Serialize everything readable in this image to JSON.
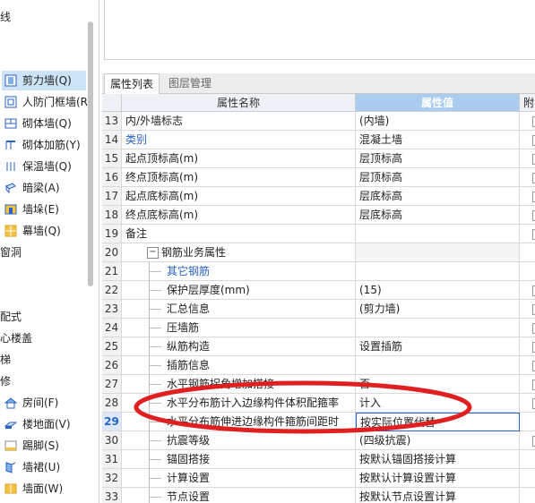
{
  "left_panel": {
    "top_text": "线",
    "items": [
      {
        "label": "剪力墙(Q)",
        "icon": "shear-wall-icon",
        "selected": true
      },
      {
        "label": "人防门框墙(R",
        "icon": "civil-defense-door-frame-icon"
      },
      {
        "label": "砌体墙(Q)",
        "icon": "masonry-wall-icon"
      },
      {
        "label": "砌体加筋(Y)",
        "icon": "masonry-reinforcement-icon"
      },
      {
        "label": "保温墙(Q)",
        "icon": "insulation-wall-icon"
      },
      {
        "label": "暗梁(A)",
        "icon": "hidden-beam-icon"
      },
      {
        "label": "墙垛(E)",
        "icon": "wall-pier-icon"
      },
      {
        "label": "幕墙(Q)",
        "icon": "curtain-wall-icon"
      }
    ],
    "group1": "窗洞",
    "group2_items": [
      "配式",
      "心楼盖",
      "梯",
      "修"
    ],
    "deco_items": [
      {
        "label": "房间(F)",
        "icon": "room-icon"
      },
      {
        "label": "楼地面(V)",
        "icon": "floor-icon"
      },
      {
        "label": "踢脚(S)",
        "icon": "skirting-icon"
      },
      {
        "label": "墙裙(U)",
        "icon": "dado-icon"
      },
      {
        "label": "墙面(W)",
        "icon": "wall-surface-icon"
      }
    ]
  },
  "tabs": [
    "属性列表",
    "图层管理"
  ],
  "grid": {
    "header": {
      "name": "属性名称",
      "value": "属性值",
      "extra": "附"
    },
    "rows": [
      {
        "num": "13",
        "name": "内/外墙标志",
        "value": "(内墙)",
        "check": true
      },
      {
        "num": "14",
        "name": "类别",
        "value": "混凝土墙",
        "check": true,
        "blue": true
      },
      {
        "num": "15",
        "name": "起点顶标高(m)",
        "value": "层顶标高",
        "check": true
      },
      {
        "num": "16",
        "name": "终点顶标高(m)",
        "value": "层顶标高",
        "check": true
      },
      {
        "num": "17",
        "name": "起点底标高(m)",
        "value": "层底标高",
        "check": true
      },
      {
        "num": "18",
        "name": "终点底标高(m)",
        "value": "层底标高",
        "check": true
      },
      {
        "num": "19",
        "name": "备注",
        "value": "",
        "check": true
      },
      {
        "num": "20",
        "name": "钢筋业务属性",
        "value": "",
        "group": true
      },
      {
        "num": "21",
        "name": "其它钢筋",
        "value": "",
        "child": true,
        "blue": true
      },
      {
        "num": "22",
        "name": "保护层厚度(mm)",
        "value": "(15)",
        "child": true,
        "check": true
      },
      {
        "num": "23",
        "name": "汇总信息",
        "value": "(剪力墙)",
        "child": true,
        "check": true
      },
      {
        "num": "24",
        "name": "压墙筋",
        "value": "",
        "child": true,
        "check": true
      },
      {
        "num": "25",
        "name": "纵筋构造",
        "value": "设置插筋",
        "child": true,
        "check": true
      },
      {
        "num": "26",
        "name": "插筋信息",
        "value": "",
        "child": true,
        "check": true
      },
      {
        "num": "27",
        "name": "水平钢筋拐角增加搭接",
        "value": "否",
        "child": true,
        "check": true
      },
      {
        "num": "28",
        "name": "水平分布筋计入边缘构件体积配箍率",
        "value": "计入",
        "child": true,
        "check": true
      },
      {
        "num": "29",
        "name": "水平分布筋伸进边缘构件箍筋间距时",
        "value": "按实际位置代替",
        "child": true,
        "current": true
      },
      {
        "num": "30",
        "name": "抗震等级",
        "value": "(四级抗震)",
        "child": true,
        "check": true
      },
      {
        "num": "31",
        "name": "锚固搭接",
        "value": "按默认锚固搭接计算",
        "child": true
      },
      {
        "num": "32",
        "name": "计算设置",
        "value": "按默认计算设置计算",
        "child": true
      },
      {
        "num": "33",
        "name": "节点设置",
        "value": "按默认节点设置计算",
        "child": true
      }
    ]
  },
  "colors": {
    "accent": "#2a62c4",
    "header_sel": "#a9ccef",
    "ellipse": "#e02020",
    "selected_bg": "#cde3f7"
  }
}
